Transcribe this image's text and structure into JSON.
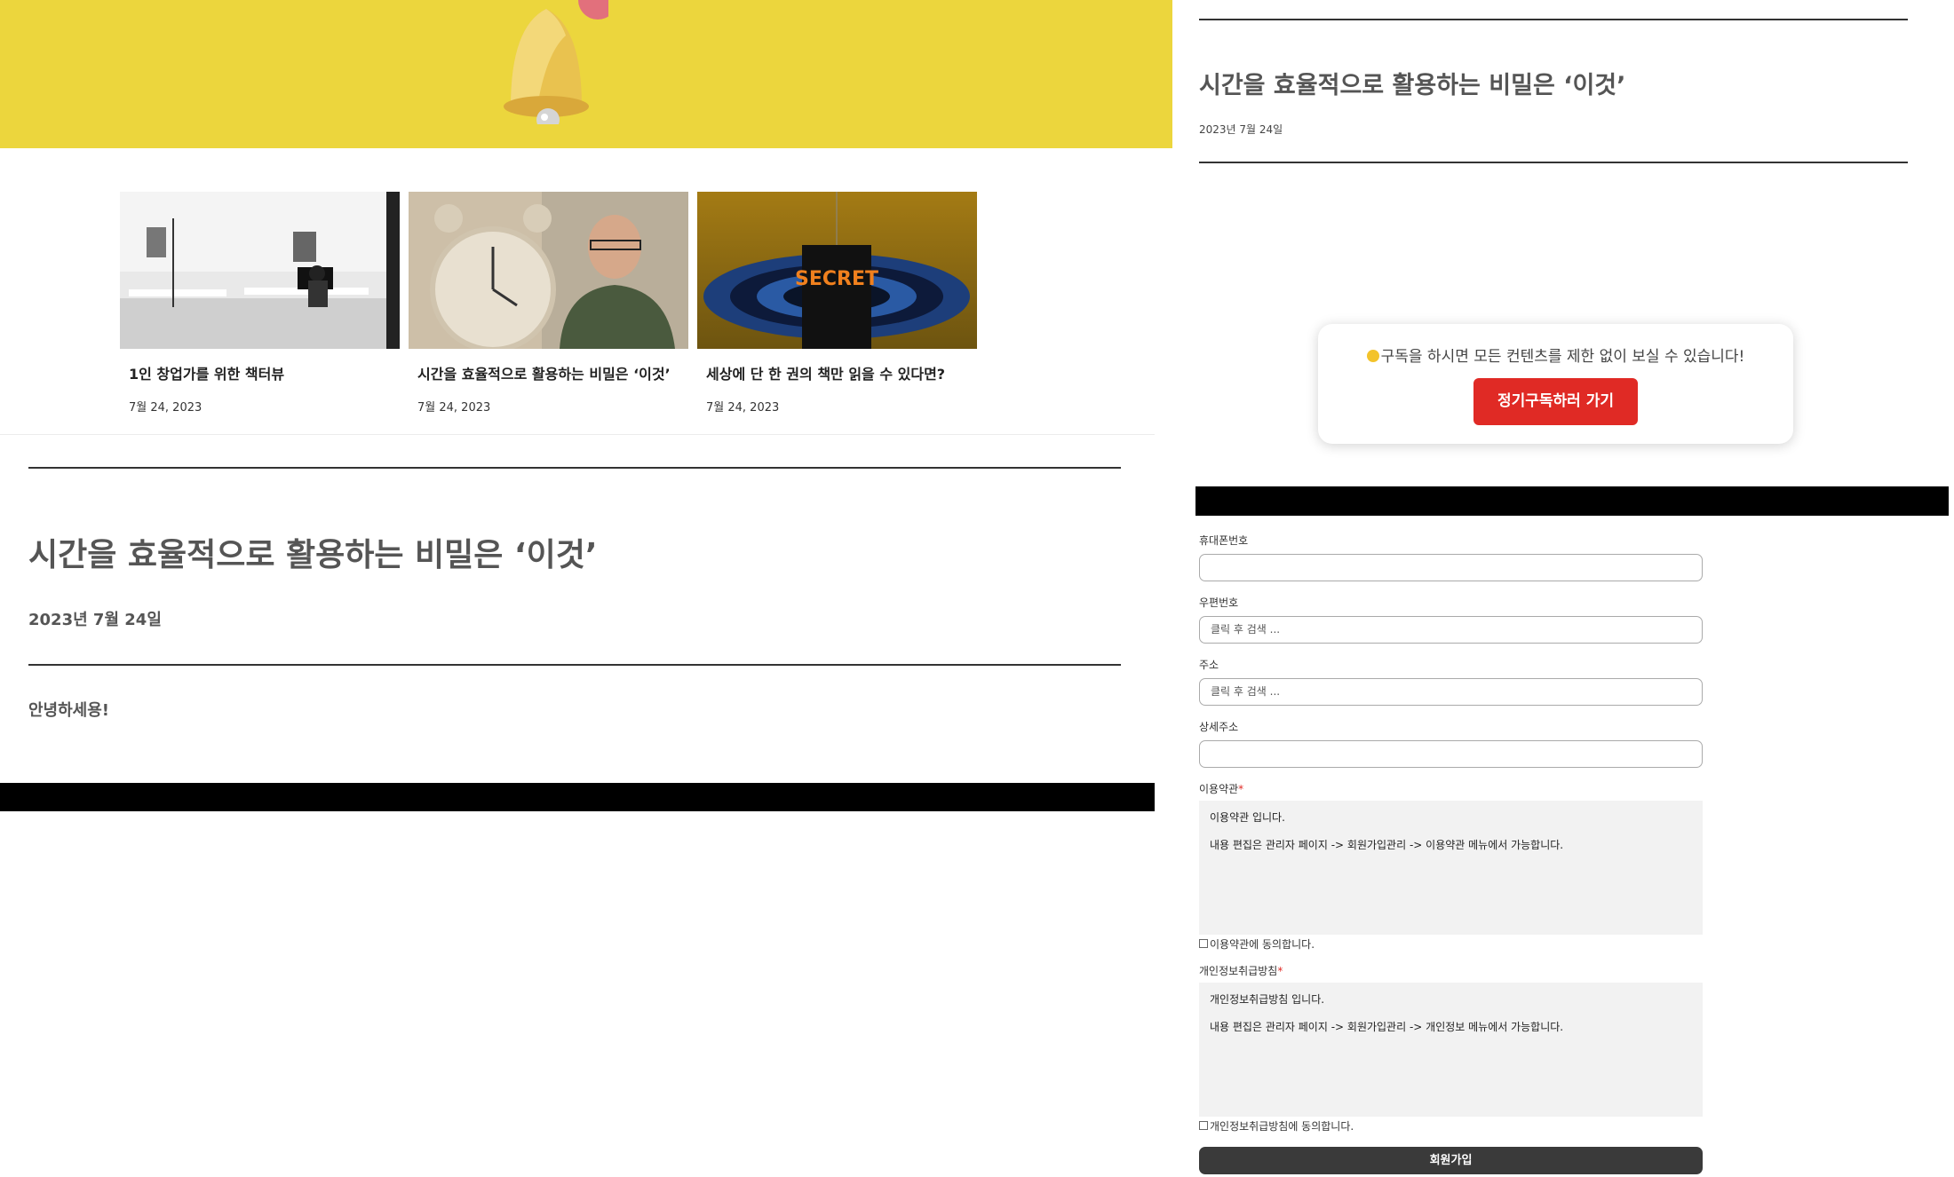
{
  "left": {
    "cards": [
      {
        "title": "1인 창업가를 위한 책터뷰",
        "date": "7월 24, 2023"
      },
      {
        "title": "시간을 효율적으로 활용하는 비밀은 ‘이것’",
        "date": "7월 24, 2023"
      },
      {
        "title": "세상에 단 한 권의 책만 읽을 수 있다면?",
        "date": "7월 24, 2023"
      }
    ],
    "secret_book_text": "SECRET",
    "post": {
      "title": "시간을 효율적으로 활용하는 비밀은 ‘이것’",
      "date": "2023년 7월 24일",
      "body": "안녕하세용!"
    }
  },
  "right": {
    "post": {
      "title": "시간을 효율적으로 활용하는 비밀은 ‘이것’",
      "date": "2023년 7월 24일"
    },
    "promo": {
      "text": "구독을 하시면 모든 컨텐츠를 제한 없이 보실 수 있습니다!",
      "button": "정기구독하러 가기"
    },
    "form": {
      "phone_label": "휴대폰번호",
      "phone_value": "",
      "zip_label": "우편번호",
      "zip_placeholder": "클릭 후 검색 ...",
      "address_label": "주소",
      "address_placeholder": "클릭 후 검색 ...",
      "detail_label": "상세주소",
      "detail_value": "",
      "terms_label": "이용약관",
      "required_mark": "*",
      "terms_line1": "이용약관 입니다.",
      "terms_line2": "내용 편집은 관리자 페이지 -> 회원가입관리 -> 이용약관 메뉴에서 가능합니다.",
      "terms_agree": "이용약관에 동의합니다.",
      "privacy_label": "개인정보취급방침",
      "privacy_line1": "개인정보취급방침 입니다.",
      "privacy_line2": "내용 편집은 관리자 페이지 -> 회원가입관리 -> 개인정보 메뉴에서 가능합니다.",
      "privacy_agree": "개인정보취급방침에 동의합니다.",
      "submit": "회원가입"
    }
  },
  "colors": {
    "hero_yellow": "#ecd63d",
    "promo_button_red": "#e02a25",
    "submit_dark": "#3a3a3a"
  }
}
